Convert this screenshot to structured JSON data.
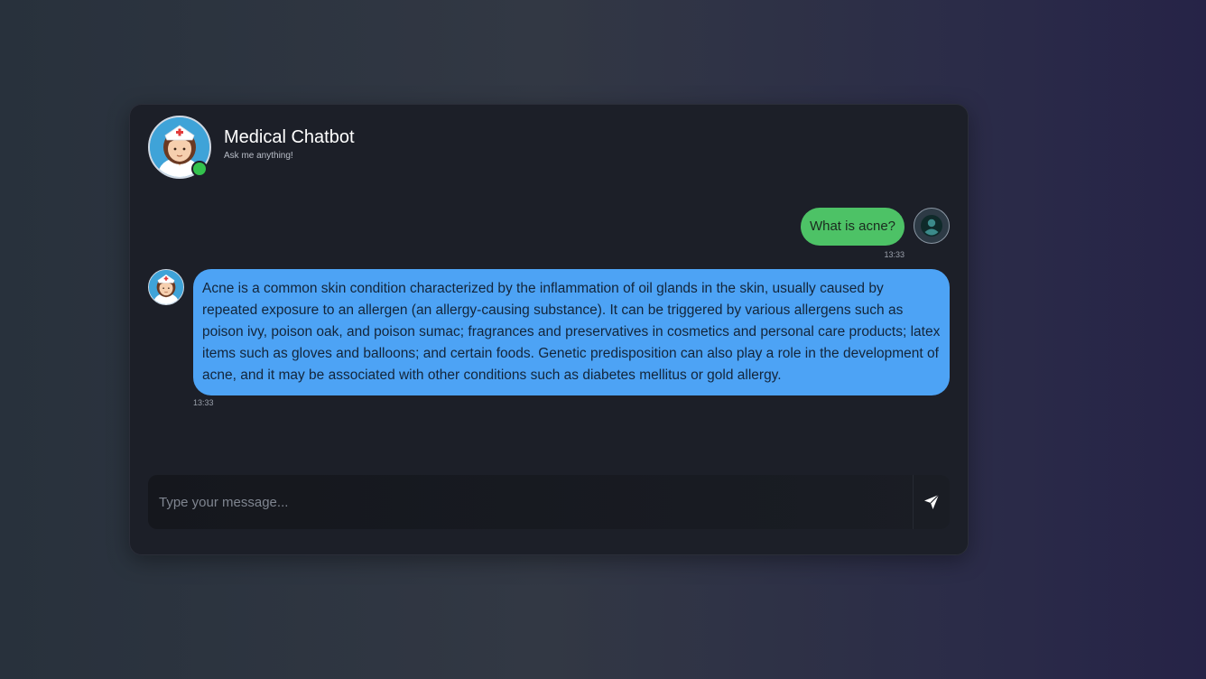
{
  "header": {
    "title": "Medical Chatbot",
    "subtitle": "Ask me anything!",
    "status": "online",
    "bot_avatar_icon": "nurse-avatar-icon"
  },
  "messages": [
    {
      "sender": "user",
      "text": "What is acne?",
      "time": "13:33",
      "avatar_icon": "user-avatar-icon"
    },
    {
      "sender": "bot",
      "text": "Acne is a common skin condition characterized by the inflammation of oil glands in the skin, usually caused by repeated exposure to an allergen (an allergy-causing substance). It can be triggered by various allergens such as poison ivy, poison oak, and poison sumac; fragrances and preservatives in cosmetics and personal care products; latex items such as gloves and balloons; and certain foods. Genetic predisposition can also play a role in the development of acne, and it may be associated with other conditions such as diabetes mellitus or gold allergy.",
      "time": "13:33",
      "avatar_icon": "nurse-avatar-icon"
    }
  ],
  "composer": {
    "placeholder": "Type your message...",
    "value": "",
    "send_icon": "send-icon"
  },
  "colors": {
    "user_bubble": "#4dc266",
    "bot_bubble": "#4da3f5",
    "card_background": "#1c1f28",
    "online_status": "#33c24d"
  }
}
